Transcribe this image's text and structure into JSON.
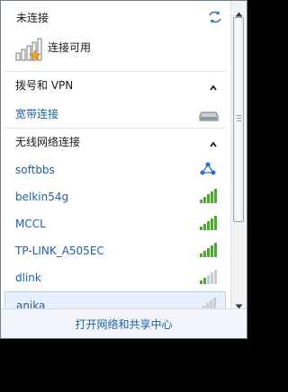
{
  "status": {
    "title": "未连接",
    "connection_available": "连接可用"
  },
  "sections": {
    "dialup_header": "拨号和 VPN",
    "broadband": "宽带连接",
    "wireless_header": "无线网络连接"
  },
  "networks": [
    {
      "name": "softbbs",
      "signal": "adhoc"
    },
    {
      "name": "belkin54g",
      "signal": 5
    },
    {
      "name": "MCCL",
      "signal": 5
    },
    {
      "name": "TP-LINK_A505EC",
      "signal": 5
    },
    {
      "name": "dlink",
      "signal": 2
    },
    {
      "name": "anjka",
      "signal": 1
    }
  ],
  "footer": {
    "link": "打开网络和共享中心"
  },
  "colors": {
    "link_blue": "#1e5fa8",
    "signal_green": "#4caa2f",
    "signal_empty": "#c9cdd1",
    "star": "#f2a51a"
  }
}
